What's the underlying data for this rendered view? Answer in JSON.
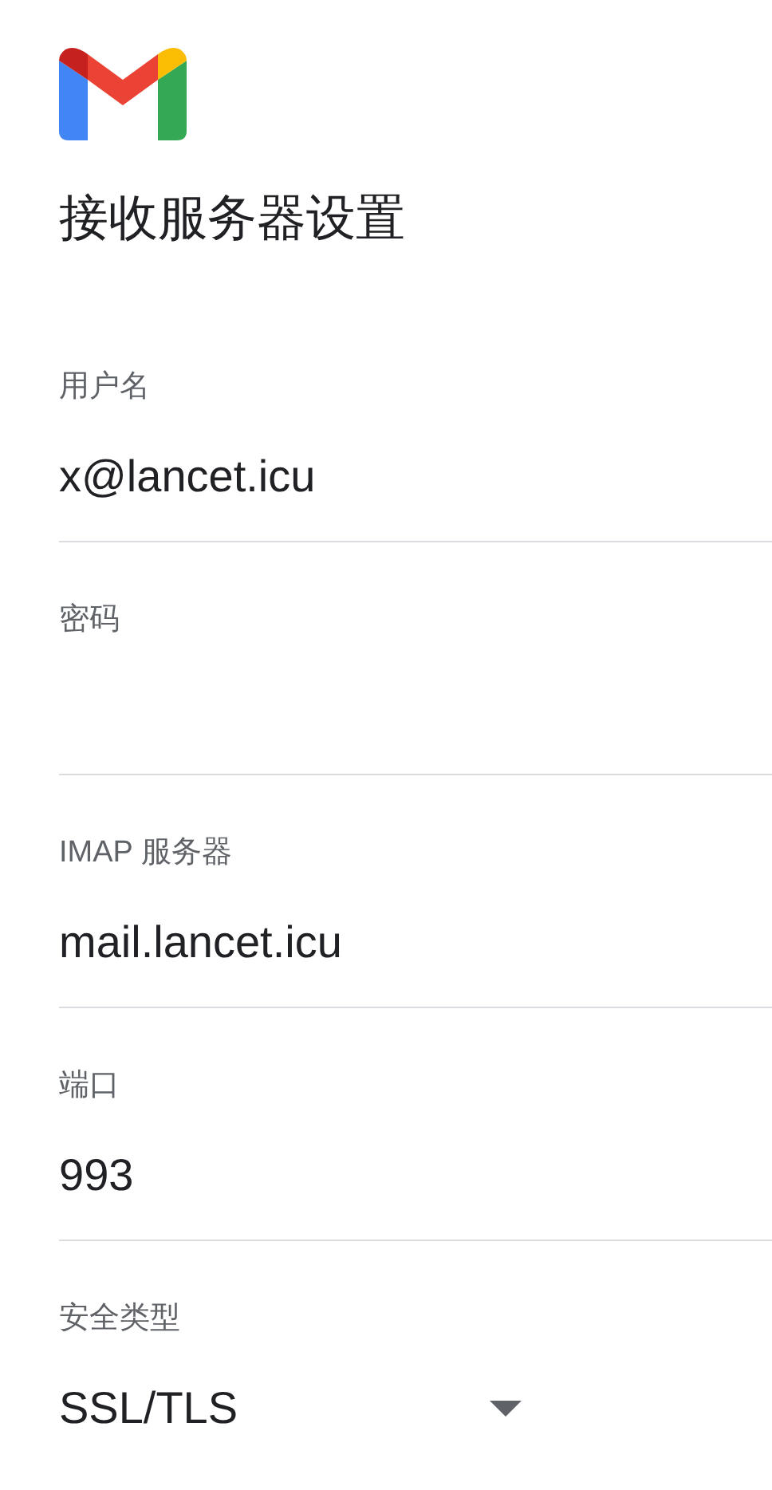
{
  "title": "接收服务器设置",
  "fields": [
    {
      "kind": "text",
      "label": "用户名",
      "value": "x@lancet.icu"
    },
    {
      "kind": "password",
      "label": "密码"
    },
    {
      "kind": "text",
      "label": "IMAP 服务器",
      "value": "mail.lancet.icu"
    },
    {
      "kind": "text",
      "label": "端口",
      "value": "993"
    },
    {
      "kind": "select",
      "label": "安全类型",
      "value": "SSL/TLS"
    }
  ]
}
